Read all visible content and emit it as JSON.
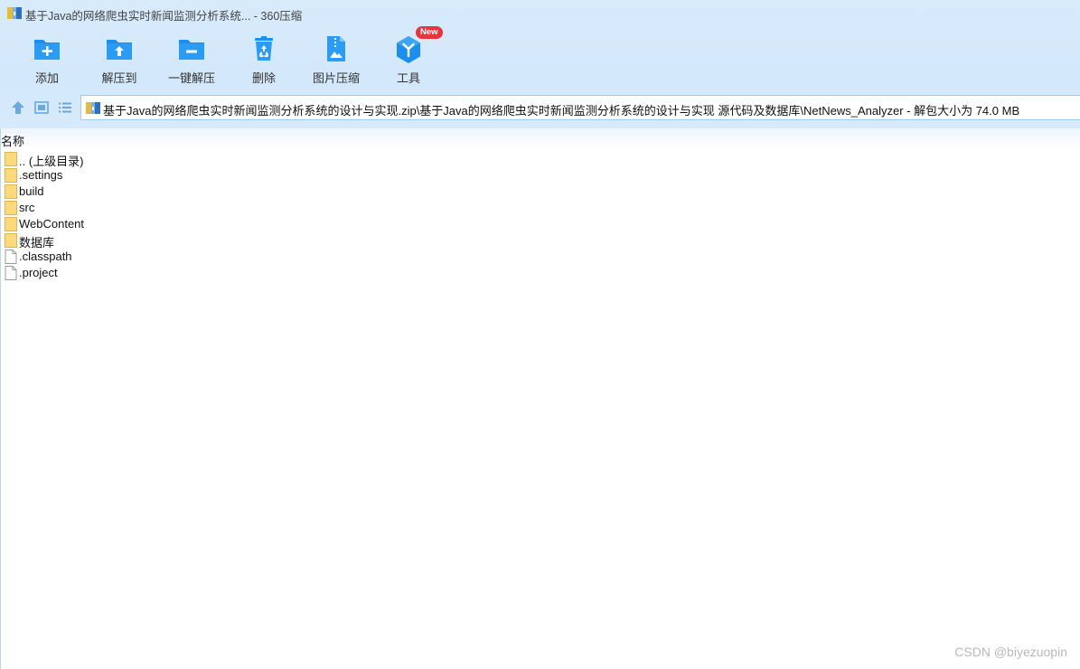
{
  "window": {
    "title": "基于Java的网络爬虫实时新闻监测分析系统... - 360压缩"
  },
  "toolbar": {
    "add_label": "添加",
    "extract_to_label": "解压到",
    "one_click_extract_label": "一键解压",
    "delete_label": "删除",
    "image_compress_label": "图片压缩",
    "tools_label": "工具",
    "tools_badge": "New"
  },
  "address_bar": {
    "path": "基于Java的网络爬虫实时新闻监测分析系统的设计与实现.zip\\基于Java的网络爬虫实时新闻监测分析系统的设计与实现 源代码及数据库\\NetNews_Analyzer - 解包大小为 74.0 MB"
  },
  "list": {
    "column_name": "名称",
    "items": [
      {
        "name": ".. (上级目录)",
        "type": "folder"
      },
      {
        "name": ".settings",
        "type": "folder"
      },
      {
        "name": "build",
        "type": "folder"
      },
      {
        "name": "src",
        "type": "folder"
      },
      {
        "name": "WebContent",
        "type": "folder"
      },
      {
        "name": "数据库",
        "type": "folder"
      },
      {
        "name": ".classpath",
        "type": "file"
      },
      {
        "name": ".project",
        "type": "file"
      }
    ]
  },
  "watermark": "CSDN @biyezuopin",
  "colors": {
    "accent": "#1a8ff0",
    "toolbar_bg": "#d6eafb",
    "folder": "#fcd97a",
    "badge": "#e8353b"
  }
}
